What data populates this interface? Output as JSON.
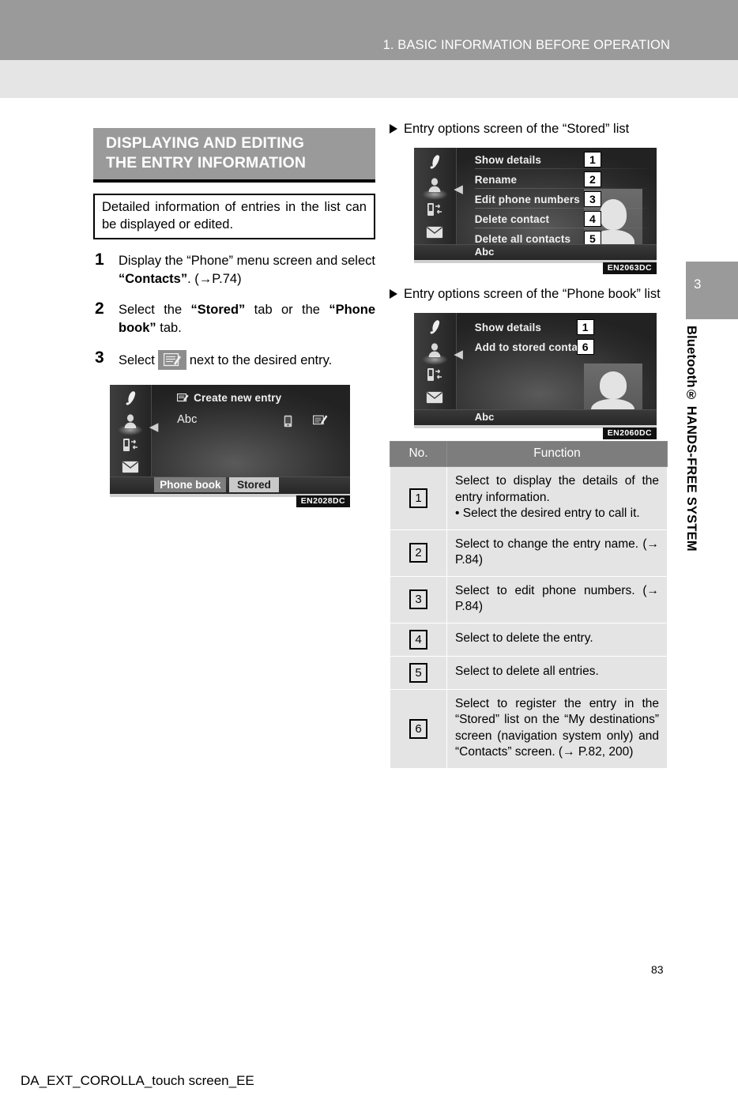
{
  "header": {
    "chapter_title": "1. BASIC INFORMATION BEFORE OPERATION"
  },
  "side_tab": {
    "chapter_number": "3",
    "chapter_name": "Bluetooth® HANDS-FREE SYSTEM"
  },
  "section": {
    "heading_line1": "DISPLAYING AND EDITING",
    "heading_line2": "THE ENTRY INFORMATION",
    "intro": "Detailed information of entries in the list can be displayed or edited."
  },
  "steps": [
    {
      "number": "1",
      "text_a": "Display the “Phone” menu screen and select ",
      "bold_b": "“Contacts”",
      "text_c": ". (→P.74)"
    },
    {
      "number": "2",
      "text_a": "Select the ",
      "bold_b": "“Stored”",
      "text_c": " tab or the ",
      "bold_d": "“Phone book”",
      "text_e": " tab."
    },
    {
      "number": "3",
      "text_a": "Select",
      "icon": "edit-entry-icon",
      "text_c": "next to the desired entry."
    }
  ],
  "figure_contacts": {
    "code": "EN2028DC",
    "create_new_entry": "Create new entry",
    "entry_name": "Abc",
    "tab_phone_book": "Phone book",
    "tab_stored": "Stored",
    "rail_icons": [
      "phone-handset-icon",
      "contacts-person-icon",
      "call-transfer-icon",
      "message-envelope-icon",
      "back-arrow-icon"
    ],
    "row_icons": [
      "mobile-phone-icon",
      "edit-entry-icon"
    ]
  },
  "right_column": {
    "caption_stored": "Entry options screen of the “Stored” list",
    "caption_phonebook": "Entry options screen of the “Phone book” list"
  },
  "figure_stored": {
    "code": "EN2063DC",
    "footer_label": "Abc",
    "rows": [
      {
        "label": "Show details",
        "callout": "1"
      },
      {
        "label": "Rename",
        "callout": "2"
      },
      {
        "label": "Edit phone numbers",
        "callout": "3"
      },
      {
        "label": "Delete contact",
        "callout": "4"
      },
      {
        "label": "Delete all contacts",
        "callout": "5"
      }
    ],
    "rail_icons": [
      "phone-handset-icon",
      "contacts-person-icon",
      "call-transfer-icon",
      "message-envelope-icon",
      "back-arrow-icon"
    ]
  },
  "figure_phonebook": {
    "code": "EN2060DC",
    "footer_label": "Abc",
    "rows": [
      {
        "label": "Show details",
        "callout": "1"
      },
      {
        "label": "Add to stored contacts",
        "callout": "6"
      }
    ],
    "rail_icons": [
      "phone-handset-icon",
      "contacts-person-icon",
      "call-transfer-icon",
      "message-envelope-icon",
      "back-arrow-icon"
    ]
  },
  "table": {
    "header_no": "No.",
    "header_function": "Function",
    "rows": [
      {
        "no": "1",
        "function": "Select to display the details of the entry information.",
        "sub": "• Select the desired entry to call it."
      },
      {
        "no": "2",
        "function": "Select to change the entry name. (→ P.84)",
        "sub": ""
      },
      {
        "no": "3",
        "function": "Select to edit phone numbers. (→ P.84)",
        "sub": ""
      },
      {
        "no": "4",
        "function": "Select to delete the entry.",
        "sub": ""
      },
      {
        "no": "5",
        "function": "Select to delete all entries.",
        "sub": ""
      },
      {
        "no": "6",
        "function": "Select to register the entry in the “Stored” list on the “My destinations” screen (navigation system only) and “Contacts” screen. (→ P.82, 200)",
        "sub": ""
      }
    ]
  },
  "footer": {
    "page_number": "83",
    "document_code": "DA_EXT_COROLLA_touch screen_EE"
  },
  "colors": {
    "band_dark": "#9a9a9a",
    "band_light": "#e5e5e5",
    "table_header": "#7d7d7d",
    "table_cell": "#e4e4e4"
  }
}
